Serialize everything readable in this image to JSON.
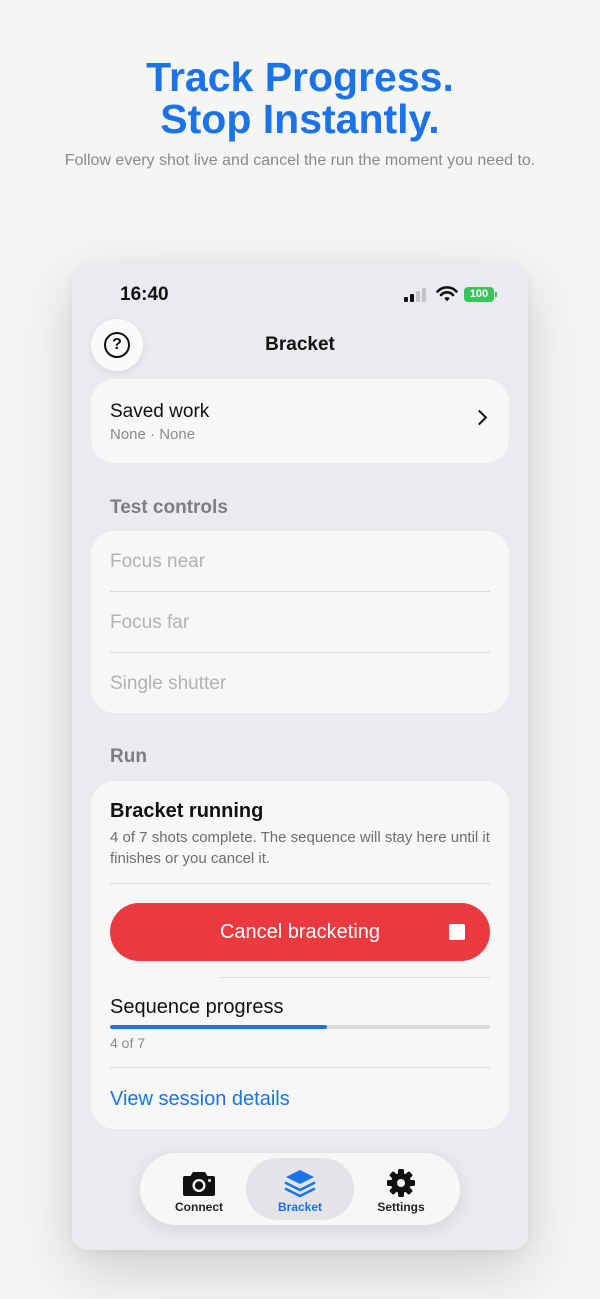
{
  "promo": {
    "title_line1": "Track Progress.",
    "title_line2": "Stop Instantly.",
    "subtitle": "Follow every shot live and cancel the run the moment you need to."
  },
  "status_bar": {
    "time": "16:40",
    "battery": "100",
    "battery_color": "#35c759"
  },
  "nav": {
    "title": "Bracket",
    "help_icon": "question-circle-icon"
  },
  "saved_work": {
    "title": "Saved work",
    "subtitle": "None · None"
  },
  "test_controls": {
    "section_label": "Test controls",
    "items": [
      {
        "label": "Focus near"
      },
      {
        "label": "Focus far"
      },
      {
        "label": "Single shutter"
      }
    ]
  },
  "run": {
    "section_label": "Run",
    "status_title": "Bracket running",
    "status_description": "4 of 7 shots complete. The sequence will stay here until it finishes or you cancel it.",
    "cancel_label": "Cancel bracketing",
    "cancel_color": "#ea3a3f",
    "progress_label": "Sequence progress",
    "progress_count": "4 of 7",
    "progress_fraction": 0.5714,
    "details_link": "View session details"
  },
  "tabs": [
    {
      "label": "Connect",
      "icon": "camera-icon",
      "active": false
    },
    {
      "label": "Bracket",
      "icon": "stack-icon",
      "active": true
    },
    {
      "label": "Settings",
      "icon": "gear-icon",
      "active": false
    }
  ],
  "accent_color": "#1a73e8"
}
